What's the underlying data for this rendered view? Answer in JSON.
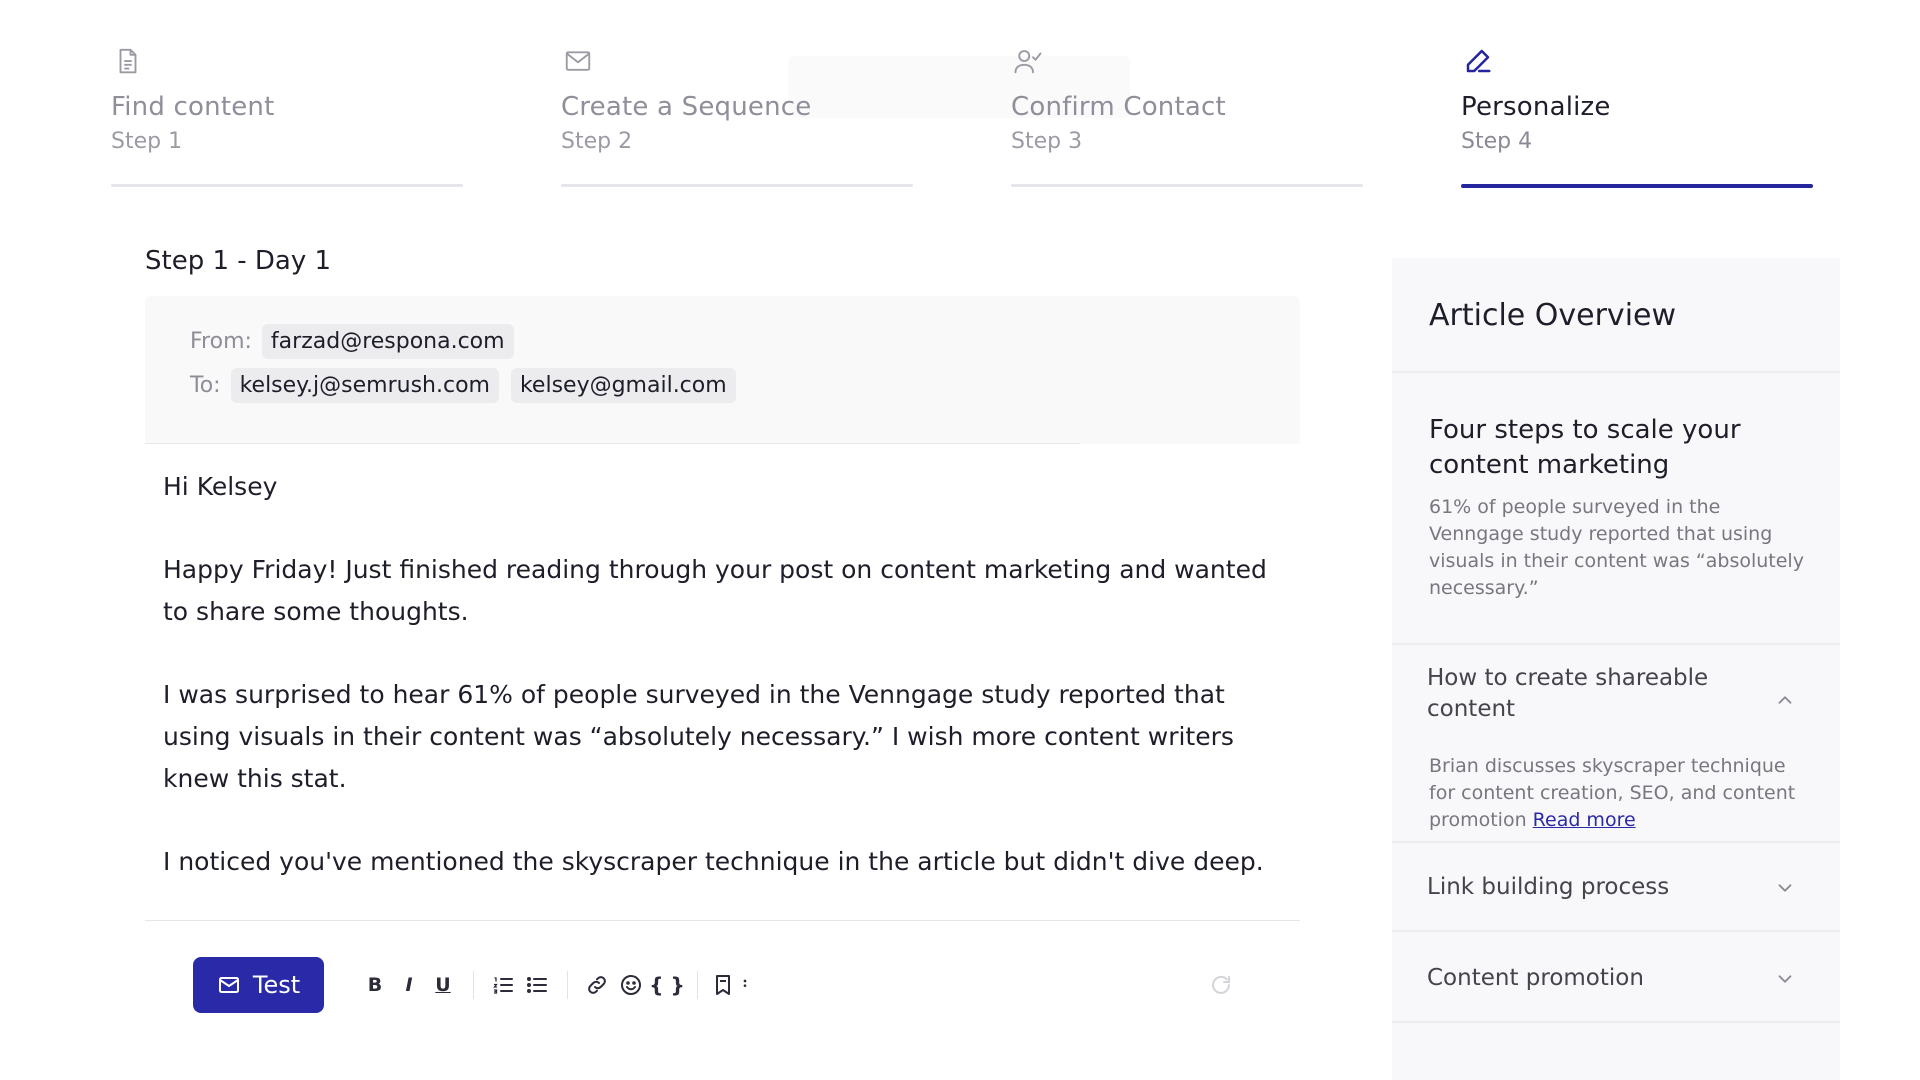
{
  "stepper": {
    "steps": [
      {
        "title": "Find content",
        "sub": "Step 1",
        "icon": "document-icon",
        "active": false
      },
      {
        "title": "Create a Sequence",
        "sub": "Step 2",
        "icon": "mail-icon",
        "active": false
      },
      {
        "title": "Confirm Contact",
        "sub": "Step 3",
        "icon": "user-check-icon",
        "active": false
      },
      {
        "title": "Personalize",
        "sub": "Step 4",
        "icon": "pen-icon",
        "active": true
      }
    ],
    "active_color": "#25259e"
  },
  "editor": {
    "heading": "Step 1 - Day 1",
    "from_label": "From:",
    "from_email": "farzad@respona.com",
    "to_label": "To:",
    "to_emails": [
      "kelsey.j@semrush.com",
      "kelsey@gmail.com"
    ],
    "body": [
      "Hi Kelsey",
      "Happy Friday! Just finished reading through your post on content marketing and wanted to share some thoughts.",
      "I was surprised to hear 61% of people surveyed in the Venngage study reported that using visuals in their content was “absolutely necessary.” I wish more content writers knew this stat.",
      "I noticed you've mentioned the skyscraper technique in the article but didn't dive deep."
    ]
  },
  "toolbar": {
    "test_label": "Test",
    "test_color": "#2a2aa8",
    "bold": "B",
    "italic": "I",
    "underline": "U",
    "variables": "{ }"
  },
  "sidebar": {
    "title": "Article Overview",
    "card": {
      "title": "Four steps to scale your content marketing",
      "desc": "61% of people surveyed in the Venngage study reported that using visuals in their content was “absolutely necessary.”"
    },
    "sections": [
      {
        "title": "How to create shareable content",
        "expanded": true,
        "desc": "Brian discusses skyscraper technique for content creation, SEO, and content promotion",
        "link": "Read more"
      },
      {
        "title": "Link building process",
        "expanded": false
      },
      {
        "title": "Content promotion",
        "expanded": false
      }
    ]
  }
}
